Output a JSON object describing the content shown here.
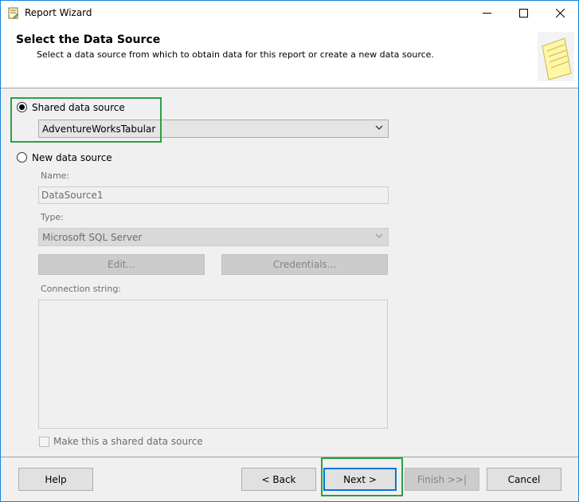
{
  "window": {
    "title": "Report Wizard",
    "icon": "report-wizard-icon",
    "controls": [
      "minimize-icon",
      "maximize-icon",
      "close-icon"
    ]
  },
  "header": {
    "title": "Select the Data Source",
    "subtitle": "Select a data source from which to obtain data for this report or create a new data source.",
    "image": "report-notepad-image"
  },
  "shared": {
    "label": "Shared data source",
    "selected": true,
    "value": "AdventureWorksTabular"
  },
  "new_source": {
    "label": "New data source",
    "selected": false,
    "name_label": "Name:",
    "name_value": "DataSource1",
    "type_label": "Type:",
    "type_value": "Microsoft SQL Server",
    "edit_label": "Edit...",
    "credentials_label": "Credentials...",
    "connection_label": "Connection string:",
    "connection_value": "",
    "make_shared_label": "Make this a shared data source",
    "make_shared_checked": false
  },
  "footer": {
    "help": "Help",
    "back": "< Back",
    "next": "Next >",
    "finish": "Finish >>|",
    "cancel": "Cancel"
  },
  "colors": {
    "highlight": "#2ea043",
    "accent": "#0078d7",
    "window_border": "#1883d7"
  }
}
